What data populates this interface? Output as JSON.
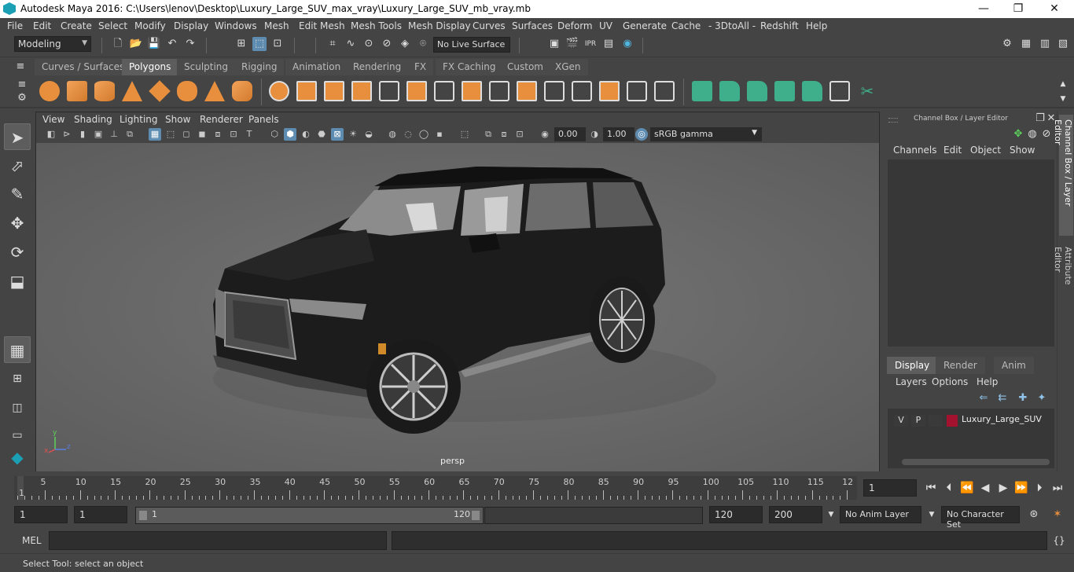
{
  "window": {
    "title": "Autodesk Maya 2016: C:\\Users\\lenov\\Desktop\\Luxury_Large_SUV_max_vray\\Luxury_Large_SUV_mb_vray.mb",
    "minimize": "—",
    "restore": "❐",
    "close": "✕"
  },
  "menu": [
    "File",
    "Edit",
    "Create",
    "Select",
    "Modify",
    "Display",
    "Windows",
    "Mesh",
    "Edit Mesh",
    "Mesh Tools",
    "Mesh Display",
    "Curves",
    "Surfaces",
    "Deform",
    "UV",
    "Generate",
    "Cache",
    "- 3DtoAll -",
    "Redshift",
    "Help"
  ],
  "statusline": {
    "mode": "Modeling",
    "live_surface": "No Live Surface"
  },
  "shelf_tabs": [
    "Curves / Surfaces",
    "Polygons",
    "Sculpting",
    "Rigging",
    "Animation",
    "Rendering",
    "FX",
    "FX Caching",
    "Custom",
    "XGen"
  ],
  "shelf_active": "Polygons",
  "viewport": {
    "menu": [
      "View",
      "Shading",
      "Lighting",
      "Show",
      "Renderer",
      "Panels"
    ],
    "exposure": "0.00",
    "gamma": "1.00",
    "color_space": "sRGB gamma",
    "camera_label": "persp",
    "axis_x": "x",
    "axis_y": "y",
    "axis_z": "z"
  },
  "channel_box": {
    "title": "Channel Box / Layer Editor",
    "menu": [
      "Channels",
      "Edit",
      "Object",
      "Show"
    ],
    "layer_tabs": [
      "Display",
      "Render",
      "Anim"
    ],
    "layer_tab_active": "Display",
    "layer_menu": [
      "Layers",
      "Options",
      "Help"
    ],
    "layer": {
      "v": "V",
      "p": "P",
      "name": "Luxury_Large_SUV",
      "color": "#a3122e"
    }
  },
  "side_tabs": [
    "Channel Box / Layer Editor",
    "Attribute Editor"
  ],
  "timeline": {
    "ticks": [
      "5",
      "10",
      "15",
      "20",
      "25",
      "30",
      "35",
      "40",
      "45",
      "50",
      "55",
      "60",
      "65",
      "70",
      "75",
      "80",
      "85",
      "90",
      "95",
      "100",
      "105",
      "110",
      "115",
      "12"
    ],
    "current_frame_marker": "1",
    "current_frame": "1"
  },
  "range": {
    "start": "1",
    "playback_start": "1",
    "slider_start": "1",
    "slider_end": "120",
    "playback_end": "120",
    "end": "200",
    "anim_layer": "No Anim Layer",
    "character_set": "No Character Set"
  },
  "cmdline": {
    "label": "MEL"
  },
  "helpline": {
    "text": "Select Tool: select an object"
  }
}
